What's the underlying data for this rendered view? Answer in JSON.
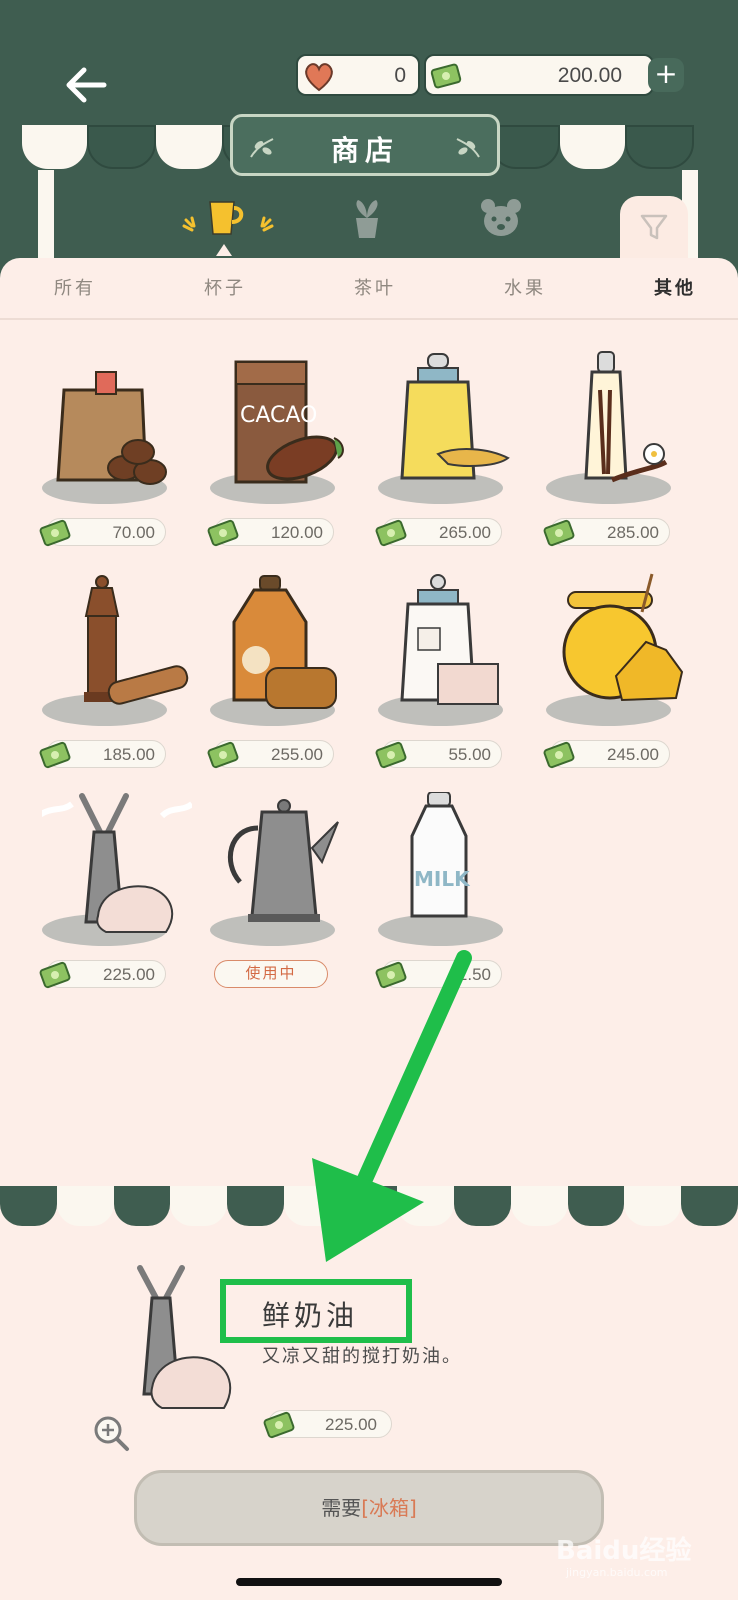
{
  "header": {
    "title": "商店",
    "hearts": "0",
    "money": "200.00"
  },
  "tabs": [
    {
      "label": "所有",
      "active": false
    },
    {
      "label": "杯子",
      "active": false
    },
    {
      "label": "茶叶",
      "active": false
    },
    {
      "label": "水果",
      "active": false
    },
    {
      "label": "其他",
      "active": true
    }
  ],
  "items": [
    {
      "icon": "coffee-beans-bag",
      "price": "70.00"
    },
    {
      "icon": "cacao-box",
      "price": "120.00"
    },
    {
      "icon": "ginger-jar",
      "price": "265.00"
    },
    {
      "icon": "vanilla-bottle",
      "price": "285.00"
    },
    {
      "icon": "pepper-grinder-cinnamon",
      "price": "185.00"
    },
    {
      "icon": "maple-syrup-bottle",
      "price": "255.00"
    },
    {
      "icon": "sugar-cube-jar",
      "price": "55.00"
    },
    {
      "icon": "honey-jar",
      "price": "245.00"
    },
    {
      "icon": "whipped-cream-dispenser",
      "price": "225.00"
    },
    {
      "icon": "coffee-kettle",
      "status": "使用中"
    },
    {
      "icon": "milk-bottle",
      "price": "2.50"
    }
  ],
  "detail": {
    "name": "鲜奶油",
    "description": "又凉又甜的搅打奶油。",
    "price": "225.00",
    "require_prefix": "需要",
    "require_item": "[冰箱]"
  },
  "watermark": {
    "text": "Baidu经验",
    "sub": "jingyan.baidu.com"
  },
  "colors": {
    "header_green": "#3f5d50",
    "panel_pink": "#fdeee8",
    "highlight_green": "#1fbe4a",
    "accent_orange": "#d97a55"
  }
}
